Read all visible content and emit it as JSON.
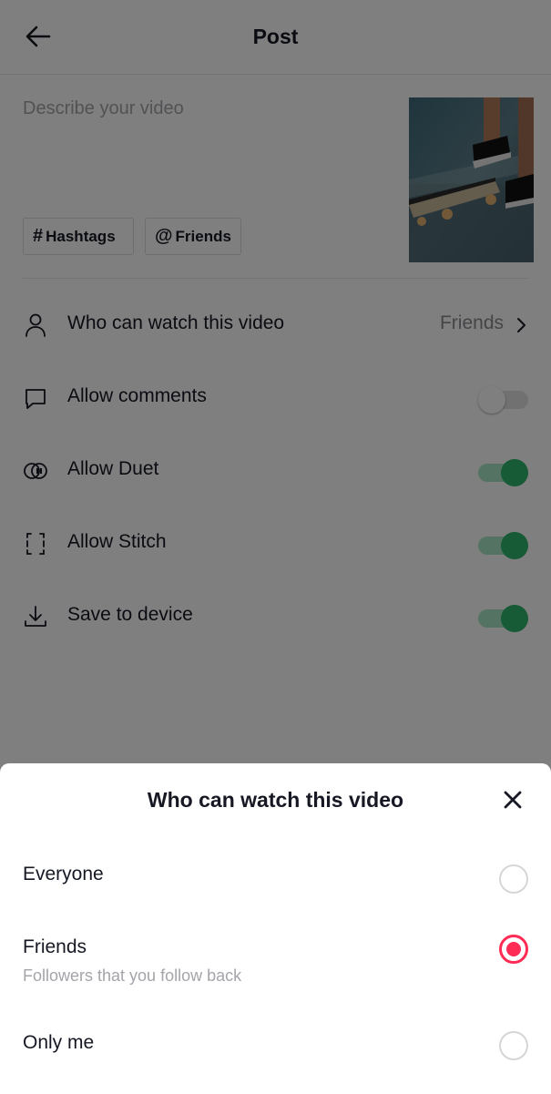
{
  "header": {
    "title": "Post",
    "back_icon": "arrow-left-icon"
  },
  "description": {
    "placeholder": "Describe your video"
  },
  "chips": [
    {
      "symbol": "#",
      "label": "Hashtags"
    },
    {
      "symbol": "@",
      "label": "Friends"
    }
  ],
  "settings": {
    "privacy": {
      "label": "Who can watch this video",
      "value": "Friends",
      "icon": "person-icon"
    },
    "comments": {
      "label": "Allow comments",
      "icon": "comment-icon",
      "enabled": false
    },
    "duet": {
      "label": "Allow Duet",
      "icon": "duet-icon",
      "enabled": true
    },
    "stitch": {
      "label": "Allow Stitch",
      "icon": "stitch-icon",
      "enabled": true
    },
    "save": {
      "label": "Save to device",
      "icon": "download-icon",
      "enabled": true
    }
  },
  "sheet": {
    "title": "Who can watch this video",
    "options": [
      {
        "label": "Everyone",
        "sublabel": "",
        "selected": false
      },
      {
        "label": "Friends",
        "sublabel": "Followers that you follow back",
        "selected": true
      },
      {
        "label": "Only me",
        "sublabel": "",
        "selected": false
      }
    ]
  },
  "colors": {
    "accent_red": "#fe2c55",
    "toggle_on": "#2cb46d",
    "text_primary": "#161823",
    "text_secondary": "#a4a5aa"
  }
}
